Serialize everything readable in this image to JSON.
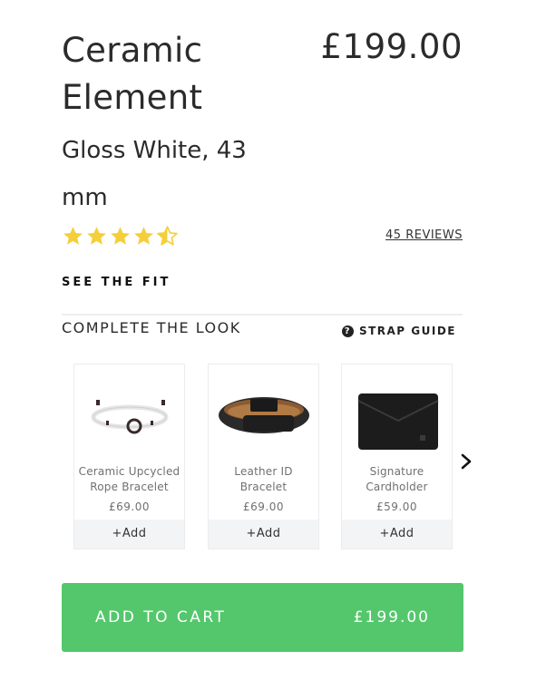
{
  "product": {
    "title": "Ceramic Element",
    "price": "£199.00",
    "variant": "Gloss White, 43 mm",
    "rating": 4.5,
    "rating_max": 5,
    "star_color": "#f5cf3b",
    "reviews_label": "45 REVIEWS"
  },
  "see_fit_label": "SEE THE FIT",
  "complete_look": {
    "title": "COMPLETE THE LOOK",
    "strap_guide_label": "STRAP GUIDE",
    "items": [
      {
        "name": "Ceramic Upcycled Rope Bracelet",
        "price": "£69.00",
        "add_label": "+Add",
        "image": "rope-bracelet-image"
      },
      {
        "name": "Leather ID Bracelet",
        "price": "£69.00",
        "add_label": "+Add",
        "image": "leather-bracelet-image"
      },
      {
        "name": "Signature Cardholder",
        "price": "£59.00",
        "add_label": "+Add",
        "image": "cardholder-image"
      }
    ]
  },
  "cart": {
    "label": "ADD TO CART",
    "price": "£199.00",
    "color": "#54c76c"
  }
}
